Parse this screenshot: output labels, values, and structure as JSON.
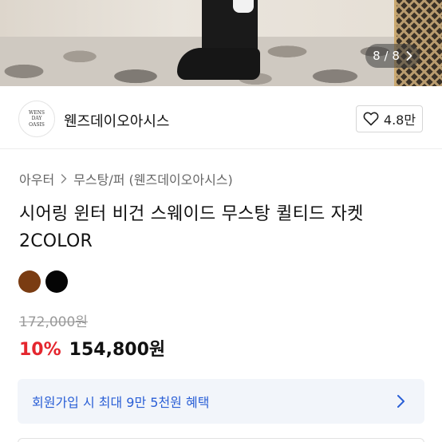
{
  "gallery": {
    "current": "8",
    "total": "8",
    "separator": "/"
  },
  "brand": {
    "logo_text": "WENS DAY OASIS",
    "name": "웬즈데이오아시스",
    "rating": "4.8만"
  },
  "breadcrumb": {
    "category": "아우터",
    "subcategory": "무스탕/퍼 (웬즈데이오아시스)"
  },
  "product": {
    "title": "시어링 윈터 비건 스웨이드 무스탕 퀼티드 자켓 2COLOR",
    "colors": [
      "#7a3c12",
      "#050505"
    ],
    "original_price": "172,000원",
    "discount": "10%",
    "sale_price": "154,800원"
  },
  "benefit": {
    "text": "회원가입 시 최대 9만 5천원 혜택"
  },
  "icons": {
    "heart": "heart-icon",
    "chevron": "chevron-right-icon"
  },
  "accent_color": "#2a5fd6",
  "discount_color": "#e4262e"
}
